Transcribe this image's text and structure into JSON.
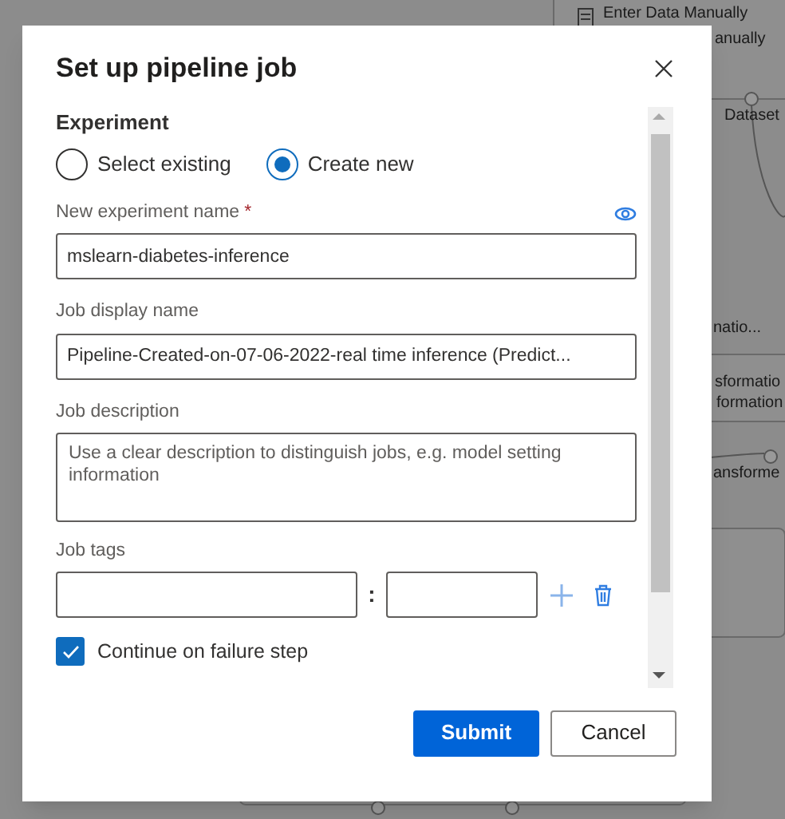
{
  "canvas": {
    "nodes": [
      {
        "texts": [
          "Enter Data Manually",
          "anually"
        ]
      },
      {
        "texts": [
          "Dataset"
        ]
      },
      {
        "texts": [
          "natio..."
        ]
      },
      {
        "texts": [
          "sformatio",
          "formation"
        ]
      },
      {
        "texts": [
          "ansforme"
        ]
      }
    ]
  },
  "dialog": {
    "title": "Set up pipeline job",
    "section": "Experiment",
    "radios": [
      {
        "label": "Select existing",
        "selected": false
      },
      {
        "label": "Create new",
        "selected": true
      }
    ],
    "fields": [
      {
        "label": "New experiment name",
        "required_mark": "*",
        "value": "mslearn-diabetes-inference",
        "kind": "name"
      },
      {
        "label": "Job display name",
        "value": "Pipeline-Created-on-07-06-2022-real time inference (Predict...",
        "kind": "text"
      },
      {
        "label": "Job description",
        "placeholder": "Use a clear description to distinguish jobs, e.g. model setting information",
        "kind": "area"
      }
    ],
    "tags": {
      "label": "Job tags",
      "separator": ":"
    },
    "checkbox": {
      "label": "Continue on failure step",
      "checked": true
    },
    "buttons": [
      {
        "label": "Submit",
        "kind": "primary"
      },
      {
        "label": "Cancel",
        "kind": "secondary"
      }
    ]
  }
}
